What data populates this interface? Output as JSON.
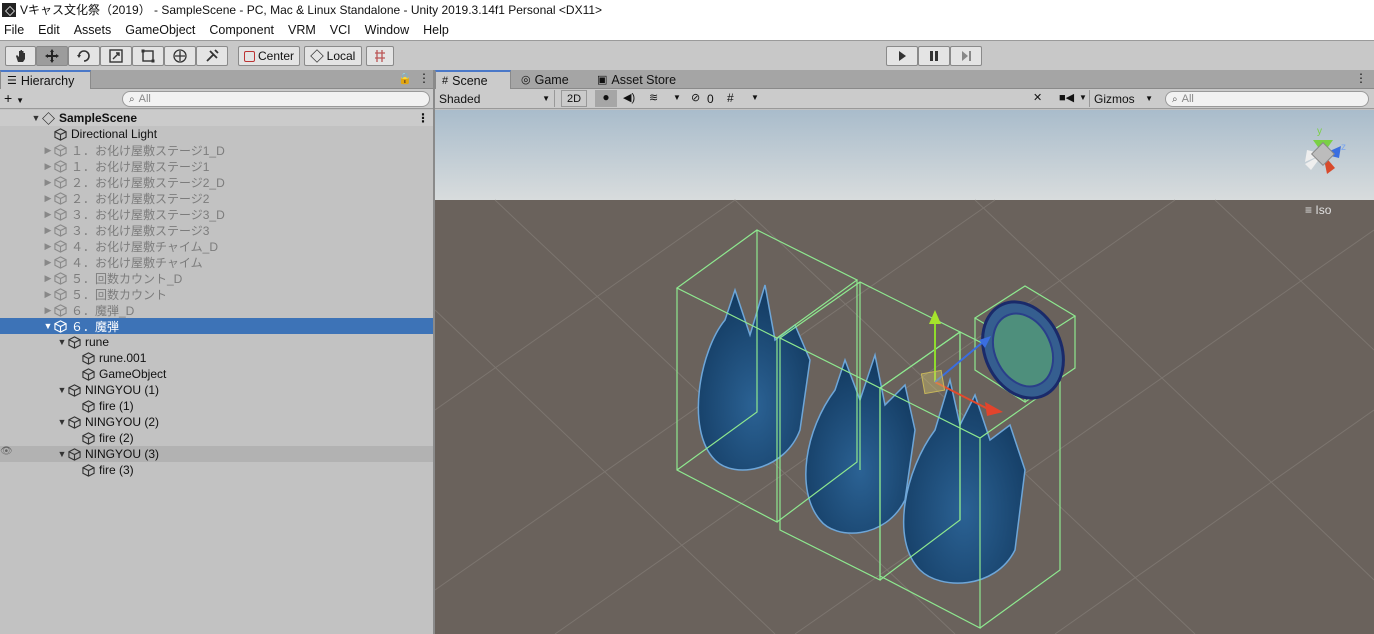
{
  "window": {
    "title": "Vキャス文化祭（2019） - SampleScene - PC, Mac & Linux Standalone - Unity 2019.3.14f1 Personal <DX11>"
  },
  "menu": [
    "File",
    "Edit",
    "Assets",
    "GameObject",
    "Component",
    "VRM",
    "VCI",
    "Window",
    "Help"
  ],
  "toolbar": {
    "tools": [
      "hand-icon",
      "move-icon",
      "rotate-icon",
      "scale-icon",
      "rect-icon",
      "transform-icon",
      "custom-tool-icon"
    ],
    "pivot_label": "Center",
    "space_label": "Local",
    "play": [
      "play-icon",
      "pause-icon",
      "step-icon"
    ]
  },
  "hierarchy": {
    "tab": "Hierarchy",
    "search_placeholder": "All",
    "scene": "SampleScene",
    "items": [
      {
        "label": "Directional Light",
        "indent": 0,
        "fold": "",
        "state": "normal"
      },
      {
        "label": "１．お化け屋敷ステージ1_D",
        "indent": 0,
        "fold": "▶",
        "state": "dim"
      },
      {
        "label": "１．お化け屋敷ステージ1",
        "indent": 0,
        "fold": "▶",
        "state": "dim"
      },
      {
        "label": "２．お化け屋敷ステージ2_D",
        "indent": 0,
        "fold": "▶",
        "state": "dim"
      },
      {
        "label": "２．お化け屋敷ステージ2",
        "indent": 0,
        "fold": "▶",
        "state": "dim"
      },
      {
        "label": "３．お化け屋敷ステージ3_D",
        "indent": 0,
        "fold": "▶",
        "state": "dim"
      },
      {
        "label": "３．お化け屋敷ステージ3",
        "indent": 0,
        "fold": "▶",
        "state": "dim"
      },
      {
        "label": "４．お化け屋敷チャイム_D",
        "indent": 0,
        "fold": "▶",
        "state": "dim"
      },
      {
        "label": "４．お化け屋敷チャイム",
        "indent": 0,
        "fold": "▶",
        "state": "dim"
      },
      {
        "label": "５．回数カウント_D",
        "indent": 0,
        "fold": "▶",
        "state": "dim"
      },
      {
        "label": "５．回数カウント",
        "indent": 0,
        "fold": "▶",
        "state": "dim"
      },
      {
        "label": "６．魔弾_D",
        "indent": 0,
        "fold": "▶",
        "state": "dim"
      },
      {
        "label": "６．魔弾",
        "indent": 0,
        "fold": "▼",
        "state": "selected"
      },
      {
        "label": "rune",
        "indent": 1,
        "fold": "▼",
        "state": "normal"
      },
      {
        "label": "rune.001",
        "indent": 2,
        "fold": "",
        "state": "normal"
      },
      {
        "label": "GameObject",
        "indent": 2,
        "fold": "",
        "state": "normal"
      },
      {
        "label": "NINGYOU (1)",
        "indent": 1,
        "fold": "▼",
        "state": "normal"
      },
      {
        "label": "fire (1)",
        "indent": 2,
        "fold": "",
        "state": "normal"
      },
      {
        "label": "NINGYOU (2)",
        "indent": 1,
        "fold": "▼",
        "state": "normal"
      },
      {
        "label": "fire (2)",
        "indent": 2,
        "fold": "",
        "state": "normal"
      },
      {
        "label": "NINGYOU (3)",
        "indent": 1,
        "fold": "▼",
        "state": "hover"
      },
      {
        "label": "fire (3)",
        "indent": 2,
        "fold": "",
        "state": "normal"
      }
    ]
  },
  "scene_view": {
    "tabs": [
      "Scene",
      "Game",
      "Asset Store"
    ],
    "shading": "Shaded",
    "mode_2d": "2D",
    "hidden_count": "0",
    "gizmos_label": "Gizmos",
    "search_placeholder": "All",
    "projection": "Iso",
    "colors": {
      "sky": "#c6d6e2",
      "ground": "#6a625c",
      "fire": "#1f4f7a",
      "bounds": "#88e08a"
    }
  }
}
